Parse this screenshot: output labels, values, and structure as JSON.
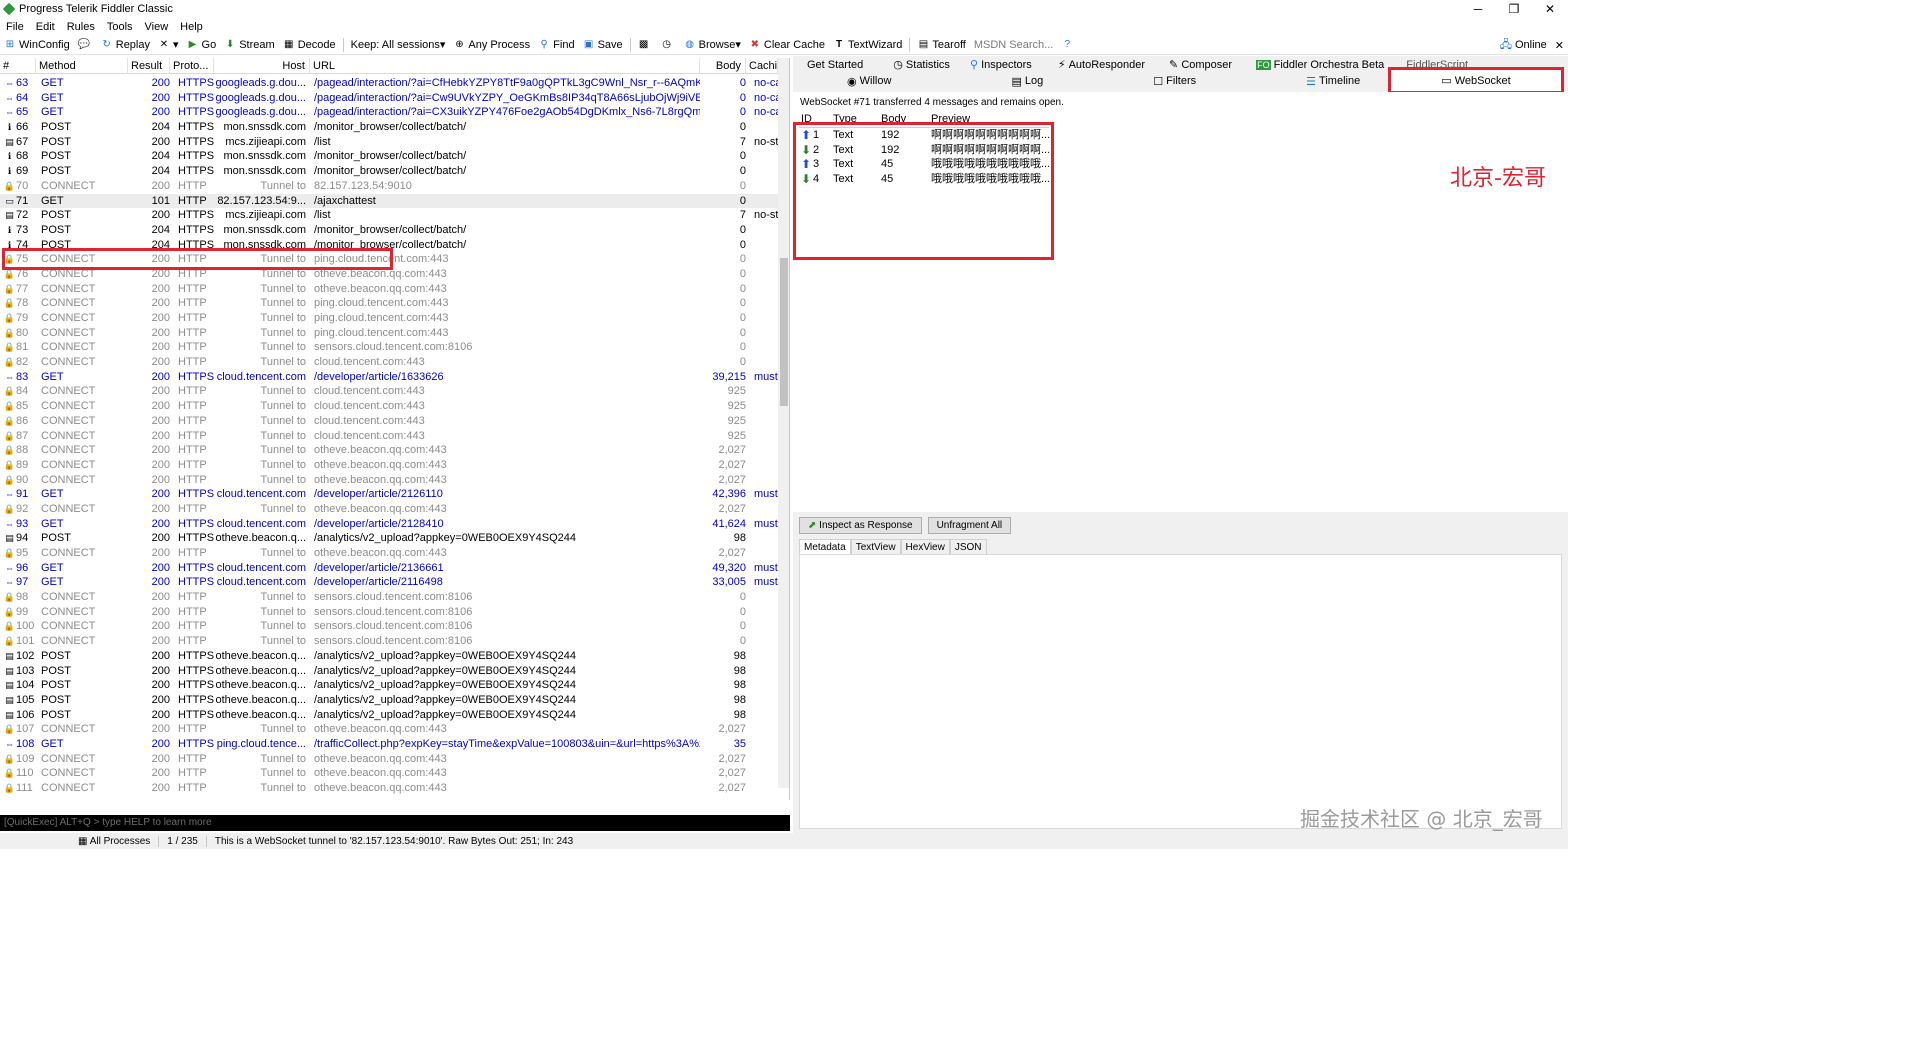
{
  "window": {
    "title": "Progress Telerik Fiddler Classic",
    "minimize": "─",
    "maximize": "❐",
    "close": "✕"
  },
  "menu": [
    "File",
    "Edit",
    "Rules",
    "Tools",
    "View",
    "Help"
  ],
  "toolbar": {
    "winconfig": "WinConfig",
    "replay": "Replay",
    "go": "Go",
    "stream": "Stream",
    "decode": "Decode",
    "keep": "Keep: All sessions",
    "any_process": "Any Process",
    "find": "Find",
    "save": "Save",
    "browse": "Browse",
    "clear_cache": "Clear Cache",
    "textwizard": "TextWizard",
    "tearoff": "Tearoff",
    "msdn_search": "MSDN Search...",
    "online": "Online"
  },
  "session_columns": [
    "#",
    "Method",
    "Result",
    "Proto...",
    "Host",
    "URL",
    "Body",
    "Cachin"
  ],
  "sessions": [
    {
      "id": "63",
      "m": "GET",
      "r": "200",
      "p": "HTTPS",
      "h": "googleads.g.dou...",
      "u": "/pagead/interaction/?ai=CfHebkYZPY8TtF9a0gQPTkL3gC9Wnl_Nsr_r--6AQmK3E4...",
      "b": "0",
      "c": "no-cac",
      "t": "blue",
      "i": "⇔"
    },
    {
      "id": "64",
      "m": "GET",
      "r": "200",
      "p": "HTTPS",
      "h": "googleads.g.dou...",
      "u": "/pagead/interaction/?ai=Cw9UVkYZPY_OeGKmBs8IP34qT8A66sLjubOjWj9iVEJitx...",
      "b": "0",
      "c": "no-cac",
      "t": "blue",
      "i": "⇔"
    },
    {
      "id": "65",
      "m": "GET",
      "r": "200",
      "p": "HTTPS",
      "h": "googleads.g.dou...",
      "u": "/pagead/interaction/?ai=CX3uikYZPY476Foe2gAOb54DgDKmlx_Ns6-7L8rgQmK3E...",
      "b": "0",
      "c": "no-cac",
      "t": "blue",
      "i": "⇔"
    },
    {
      "id": "66",
      "m": "POST",
      "r": "204",
      "p": "HTTPS",
      "h": "mon.snssdk.com",
      "u": "/monitor_browser/collect/batch/",
      "b": "0",
      "c": "",
      "t": "black",
      "i": "ℹ"
    },
    {
      "id": "67",
      "m": "POST",
      "r": "200",
      "p": "HTTPS",
      "h": "mcs.zijieapi.com",
      "u": "/list",
      "b": "7",
      "c": "no-sto",
      "t": "black",
      "i": "▤"
    },
    {
      "id": "68",
      "m": "POST",
      "r": "204",
      "p": "HTTPS",
      "h": "mon.snssdk.com",
      "u": "/monitor_browser/collect/batch/",
      "b": "0",
      "c": "",
      "t": "black",
      "i": "ℹ"
    },
    {
      "id": "69",
      "m": "POST",
      "r": "204",
      "p": "HTTPS",
      "h": "mon.snssdk.com",
      "u": "/monitor_browser/collect/batch/",
      "b": "0",
      "c": "",
      "t": "black",
      "i": "ℹ"
    },
    {
      "id": "70",
      "m": "CONNECT",
      "r": "200",
      "p": "HTTP",
      "h": "Tunnel to",
      "u": "82.157.123.54:9010",
      "b": "0",
      "c": "",
      "t": "gray",
      "i": "🔒"
    },
    {
      "id": "71",
      "m": "GET",
      "r": "101",
      "p": "HTTP",
      "h": "82.157.123.54:9...",
      "u": "/ajaxchattest",
      "b": "0",
      "c": "",
      "t": "black sel",
      "i": "▭"
    },
    {
      "id": "72",
      "m": "POST",
      "r": "200",
      "p": "HTTPS",
      "h": "mcs.zijieapi.com",
      "u": "/list",
      "b": "7",
      "c": "no-sto",
      "t": "black",
      "i": "▤"
    },
    {
      "id": "73",
      "m": "POST",
      "r": "204",
      "p": "HTTPS",
      "h": "mon.snssdk.com",
      "u": "/monitor_browser/collect/batch/",
      "b": "0",
      "c": "",
      "t": "black",
      "i": "ℹ"
    },
    {
      "id": "74",
      "m": "POST",
      "r": "204",
      "p": "HTTPS",
      "h": "mon.snssdk.com",
      "u": "/monitor_browser/collect/batch/",
      "b": "0",
      "c": "",
      "t": "black",
      "i": "ℹ"
    },
    {
      "id": "75",
      "m": "CONNECT",
      "r": "200",
      "p": "HTTP",
      "h": "Tunnel to",
      "u": "ping.cloud.tencent.com:443",
      "b": "0",
      "c": "",
      "t": "gray",
      "i": "🔒"
    },
    {
      "id": "76",
      "m": "CONNECT",
      "r": "200",
      "p": "HTTP",
      "h": "Tunnel to",
      "u": "otheve.beacon.qq.com:443",
      "b": "0",
      "c": "",
      "t": "gray",
      "i": "🔒"
    },
    {
      "id": "77",
      "m": "CONNECT",
      "r": "200",
      "p": "HTTP",
      "h": "Tunnel to",
      "u": "otheve.beacon.qq.com:443",
      "b": "0",
      "c": "",
      "t": "gray",
      "i": "🔒"
    },
    {
      "id": "78",
      "m": "CONNECT",
      "r": "200",
      "p": "HTTP",
      "h": "Tunnel to",
      "u": "ping.cloud.tencent.com:443",
      "b": "0",
      "c": "",
      "t": "gray",
      "i": "🔒"
    },
    {
      "id": "79",
      "m": "CONNECT",
      "r": "200",
      "p": "HTTP",
      "h": "Tunnel to",
      "u": "ping.cloud.tencent.com:443",
      "b": "0",
      "c": "",
      "t": "gray",
      "i": "🔒"
    },
    {
      "id": "80",
      "m": "CONNECT",
      "r": "200",
      "p": "HTTP",
      "h": "Tunnel to",
      "u": "ping.cloud.tencent.com:443",
      "b": "0",
      "c": "",
      "t": "gray",
      "i": "🔒"
    },
    {
      "id": "81",
      "m": "CONNECT",
      "r": "200",
      "p": "HTTP",
      "h": "Tunnel to",
      "u": "sensors.cloud.tencent.com:8106",
      "b": "0",
      "c": "",
      "t": "gray",
      "i": "🔒"
    },
    {
      "id": "82",
      "m": "CONNECT",
      "r": "200",
      "p": "HTTP",
      "h": "Tunnel to",
      "u": "cloud.tencent.com:443",
      "b": "0",
      "c": "",
      "t": "gray",
      "i": "🔒"
    },
    {
      "id": "83",
      "m": "GET",
      "r": "200",
      "p": "HTTPS",
      "h": "cloud.tencent.com",
      "u": "/developer/article/1633626",
      "b": "39,215",
      "c": "must-r",
      "t": "blue",
      "i": "⇔"
    },
    {
      "id": "84",
      "m": "CONNECT",
      "r": "200",
      "p": "HTTP",
      "h": "Tunnel to",
      "u": "cloud.tencent.com:443",
      "b": "925",
      "c": "",
      "t": "gray",
      "i": "🔒"
    },
    {
      "id": "85",
      "m": "CONNECT",
      "r": "200",
      "p": "HTTP",
      "h": "Tunnel to",
      "u": "cloud.tencent.com:443",
      "b": "925",
      "c": "",
      "t": "gray",
      "i": "🔒"
    },
    {
      "id": "86",
      "m": "CONNECT",
      "r": "200",
      "p": "HTTP",
      "h": "Tunnel to",
      "u": "cloud.tencent.com:443",
      "b": "925",
      "c": "",
      "t": "gray",
      "i": "🔒"
    },
    {
      "id": "87",
      "m": "CONNECT",
      "r": "200",
      "p": "HTTP",
      "h": "Tunnel to",
      "u": "cloud.tencent.com:443",
      "b": "925",
      "c": "",
      "t": "gray",
      "i": "🔒"
    },
    {
      "id": "88",
      "m": "CONNECT",
      "r": "200",
      "p": "HTTP",
      "h": "Tunnel to",
      "u": "otheve.beacon.qq.com:443",
      "b": "2,027",
      "c": "",
      "t": "gray",
      "i": "🔒"
    },
    {
      "id": "89",
      "m": "CONNECT",
      "r": "200",
      "p": "HTTP",
      "h": "Tunnel to",
      "u": "otheve.beacon.qq.com:443",
      "b": "2,027",
      "c": "",
      "t": "gray",
      "i": "🔒"
    },
    {
      "id": "90",
      "m": "CONNECT",
      "r": "200",
      "p": "HTTP",
      "h": "Tunnel to",
      "u": "otheve.beacon.qq.com:443",
      "b": "2,027",
      "c": "",
      "t": "gray",
      "i": "🔒"
    },
    {
      "id": "91",
      "m": "GET",
      "r": "200",
      "p": "HTTPS",
      "h": "cloud.tencent.com",
      "u": "/developer/article/2126110",
      "b": "42,396",
      "c": "must-r",
      "t": "blue",
      "i": "⇔"
    },
    {
      "id": "92",
      "m": "CONNECT",
      "r": "200",
      "p": "HTTP",
      "h": "Tunnel to",
      "u": "otheve.beacon.qq.com:443",
      "b": "2,027",
      "c": "",
      "t": "gray",
      "i": "🔒"
    },
    {
      "id": "93",
      "m": "GET",
      "r": "200",
      "p": "HTTPS",
      "h": "cloud.tencent.com",
      "u": "/developer/article/2128410",
      "b": "41,624",
      "c": "must-r",
      "t": "blue",
      "i": "⇔"
    },
    {
      "id": "94",
      "m": "POST",
      "r": "200",
      "p": "HTTPS",
      "h": "otheve.beacon.q...",
      "u": "/analytics/v2_upload?appkey=0WEB0OEX9Y4SQ244",
      "b": "98",
      "c": "",
      "t": "black",
      "i": "▤"
    },
    {
      "id": "95",
      "m": "CONNECT",
      "r": "200",
      "p": "HTTP",
      "h": "Tunnel to",
      "u": "otheve.beacon.qq.com:443",
      "b": "2,027",
      "c": "",
      "t": "gray",
      "i": "🔒"
    },
    {
      "id": "96",
      "m": "GET",
      "r": "200",
      "p": "HTTPS",
      "h": "cloud.tencent.com",
      "u": "/developer/article/2136661",
      "b": "49,320",
      "c": "must-r",
      "t": "blue",
      "i": "⇔"
    },
    {
      "id": "97",
      "m": "GET",
      "r": "200",
      "p": "HTTPS",
      "h": "cloud.tencent.com",
      "u": "/developer/article/2116498",
      "b": "33,005",
      "c": "must-r",
      "t": "blue",
      "i": "⇔"
    },
    {
      "id": "98",
      "m": "CONNECT",
      "r": "200",
      "p": "HTTP",
      "h": "Tunnel to",
      "u": "sensors.cloud.tencent.com:8106",
      "b": "0",
      "c": "",
      "t": "gray",
      "i": "🔒"
    },
    {
      "id": "99",
      "m": "CONNECT",
      "r": "200",
      "p": "HTTP",
      "h": "Tunnel to",
      "u": "sensors.cloud.tencent.com:8106",
      "b": "0",
      "c": "",
      "t": "gray",
      "i": "🔒"
    },
    {
      "id": "100",
      "m": "CONNECT",
      "r": "200",
      "p": "HTTP",
      "h": "Tunnel to",
      "u": "sensors.cloud.tencent.com:8106",
      "b": "0",
      "c": "",
      "t": "gray",
      "i": "🔒"
    },
    {
      "id": "101",
      "m": "CONNECT",
      "r": "200",
      "p": "HTTP",
      "h": "Tunnel to",
      "u": "sensors.cloud.tencent.com:8106",
      "b": "0",
      "c": "",
      "t": "gray",
      "i": "🔒"
    },
    {
      "id": "102",
      "m": "POST",
      "r": "200",
      "p": "HTTPS",
      "h": "otheve.beacon.q...",
      "u": "/analytics/v2_upload?appkey=0WEB0OEX9Y4SQ244",
      "b": "98",
      "c": "",
      "t": "black",
      "i": "▤"
    },
    {
      "id": "103",
      "m": "POST",
      "r": "200",
      "p": "HTTPS",
      "h": "otheve.beacon.q...",
      "u": "/analytics/v2_upload?appkey=0WEB0OEX9Y4SQ244",
      "b": "98",
      "c": "",
      "t": "black",
      "i": "▤"
    },
    {
      "id": "104",
      "m": "POST",
      "r": "200",
      "p": "HTTPS",
      "h": "otheve.beacon.q...",
      "u": "/analytics/v2_upload?appkey=0WEB0OEX9Y4SQ244",
      "b": "98",
      "c": "",
      "t": "black",
      "i": "▤"
    },
    {
      "id": "105",
      "m": "POST",
      "r": "200",
      "p": "HTTPS",
      "h": "otheve.beacon.q...",
      "u": "/analytics/v2_upload?appkey=0WEB0OEX9Y4SQ244",
      "b": "98",
      "c": "",
      "t": "black",
      "i": "▤"
    },
    {
      "id": "106",
      "m": "POST",
      "r": "200",
      "p": "HTTPS",
      "h": "otheve.beacon.q...",
      "u": "/analytics/v2_upload?appkey=0WEB0OEX9Y4SQ244",
      "b": "98",
      "c": "",
      "t": "black",
      "i": "▤"
    },
    {
      "id": "107",
      "m": "CONNECT",
      "r": "200",
      "p": "HTTP",
      "h": "Tunnel to",
      "u": "otheve.beacon.qq.com:443",
      "b": "2,027",
      "c": "",
      "t": "gray",
      "i": "🔒"
    },
    {
      "id": "108",
      "m": "GET",
      "r": "200",
      "p": "HTTPS",
      "h": "ping.cloud.tence...",
      "u": "/trafficCollect.php?expKey=stayTime&expValue=100803&uin=&url=https%3A%2F...",
      "b": "35",
      "c": "",
      "t": "blue",
      "i": "⇔"
    },
    {
      "id": "109",
      "m": "CONNECT",
      "r": "200",
      "p": "HTTP",
      "h": "Tunnel to",
      "u": "otheve.beacon.qq.com:443",
      "b": "2,027",
      "c": "",
      "t": "gray",
      "i": "🔒"
    },
    {
      "id": "110",
      "m": "CONNECT",
      "r": "200",
      "p": "HTTP",
      "h": "Tunnel to",
      "u": "otheve.beacon.qq.com:443",
      "b": "2,027",
      "c": "",
      "t": "gray",
      "i": "🔒"
    },
    {
      "id": "111",
      "m": "CONNECT",
      "r": "200",
      "p": "HTTP",
      "h": "Tunnel to",
      "u": "otheve.beacon.qq.com:443",
      "b": "2,027",
      "c": "",
      "t": "gray",
      "i": "🔒"
    }
  ],
  "quickexec": "[QuickExec] ALT+Q > type HELP to learn more",
  "status": {
    "processes": "All Processes",
    "count": "1 / 235",
    "message": "This is a WebSocket tunnel to '82.157.123.54:9010'. Raw Bytes Out: 251; In: 243"
  },
  "right_tabs_row1": [
    "Get Started",
    "Statistics",
    "Inspectors",
    "AutoResponder",
    "Composer",
    "Fiddler Orchestra Beta",
    "FiddlerScript"
  ],
  "right_tabs_row2": [
    "Willow",
    "Log",
    "Filters",
    "Timeline"
  ],
  "websocket_tab": "WebSocket",
  "ws": {
    "summary": "WebSocket #71 transferred 4 messages and remains open.",
    "columns": [
      "ID",
      "Type",
      "Body",
      "Preview"
    ],
    "messages": [
      {
        "id": "1",
        "type": "Text",
        "body": "192",
        "preview": "啊啊啊啊啊啊啊啊啊啊...",
        "dir": "up"
      },
      {
        "id": "2",
        "type": "Text",
        "body": "192",
        "preview": "啊啊啊啊啊啊啊啊啊啊...",
        "dir": "down"
      },
      {
        "id": "3",
        "type": "Text",
        "body": "45",
        "preview": "哦哦哦哦哦哦哦哦哦哦...",
        "dir": "up"
      },
      {
        "id": "4",
        "type": "Text",
        "body": "45",
        "preview": "哦哦哦哦哦哦哦哦哦哦...",
        "dir": "down"
      }
    ]
  },
  "inspect_buttons": {
    "inspect": "Inspect as Response",
    "unfragment": "Unfragment All"
  },
  "detail_tabs": [
    "Metadata",
    "TextView",
    "HexView",
    "JSON"
  ],
  "watermark_top": "北京-宏哥",
  "watermark_bottom": "掘金技术社区 @ 北京_宏哥",
  "colors": {
    "highlight": "#e02330",
    "link": "#0000cc",
    "tunnel": "#8c8c8c"
  }
}
